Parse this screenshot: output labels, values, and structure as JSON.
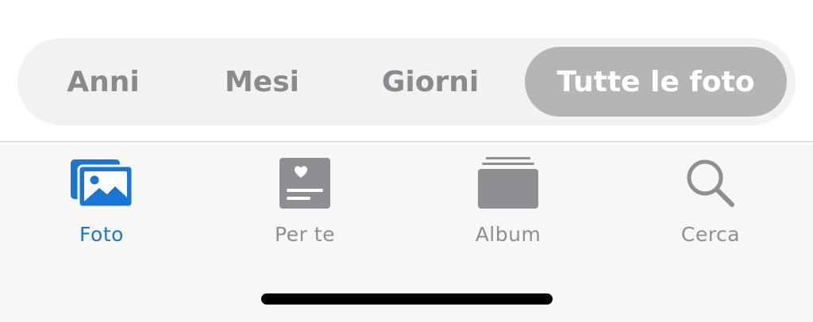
{
  "segmented_control": {
    "items": [
      {
        "label": "Anni",
        "selected": false
      },
      {
        "label": "Mesi",
        "selected": false
      },
      {
        "label": "Giorni",
        "selected": false
      },
      {
        "label": "Tutte le foto",
        "selected": true
      }
    ]
  },
  "tabbar": {
    "items": [
      {
        "label": "Foto",
        "icon": "photos-icon",
        "active": true
      },
      {
        "label": "Per te",
        "icon": "for-you-icon",
        "active": false
      },
      {
        "label": "Album",
        "icon": "albums-icon",
        "active": false
      },
      {
        "label": "Cerca",
        "icon": "search-icon",
        "active": false
      }
    ]
  },
  "colors": {
    "accent": "#1877d4",
    "inactive": "#8e8e93",
    "segment_background": "#f2f2f2",
    "segment_selected": "#b5b5b5"
  }
}
